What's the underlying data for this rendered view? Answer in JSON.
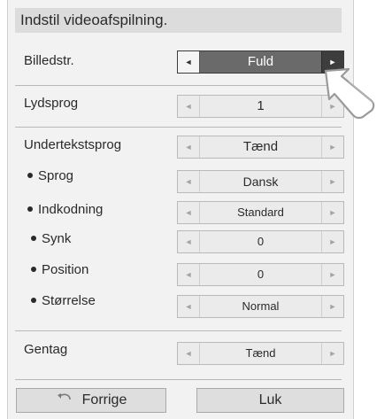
{
  "title": "Indstil videoafspilning.",
  "icons": {
    "left_arrow": "◄",
    "right_arrow": "►",
    "back": "back-arrow-icon",
    "cursor": "pointer-hand-cursor"
  },
  "settings": {
    "picture_size": {
      "label": "Billedstr.",
      "value": "Fuld"
    },
    "audio_language": {
      "label": "Lydsprog",
      "value": "1"
    },
    "subtitle_language": {
      "label": "Undertekstsprog",
      "value": "Tænd"
    },
    "language": {
      "label": "Sprog",
      "value": "Dansk"
    },
    "encoding": {
      "label": "Indkodning",
      "value": "Standard"
    },
    "sync": {
      "label": "Synk",
      "value": "0"
    },
    "position": {
      "label": "Position",
      "value": "0"
    },
    "size": {
      "label": "Størrelse",
      "value": "Normal"
    },
    "repeat": {
      "label": "Gentag",
      "value": "Tænd"
    }
  },
  "buttons": {
    "previous": "Forrige",
    "close": "Luk"
  },
  "colors": {
    "highlight": "#6a6a6a",
    "panel_bg": "#f2f2f2",
    "title_bg": "#dcdcdc"
  }
}
